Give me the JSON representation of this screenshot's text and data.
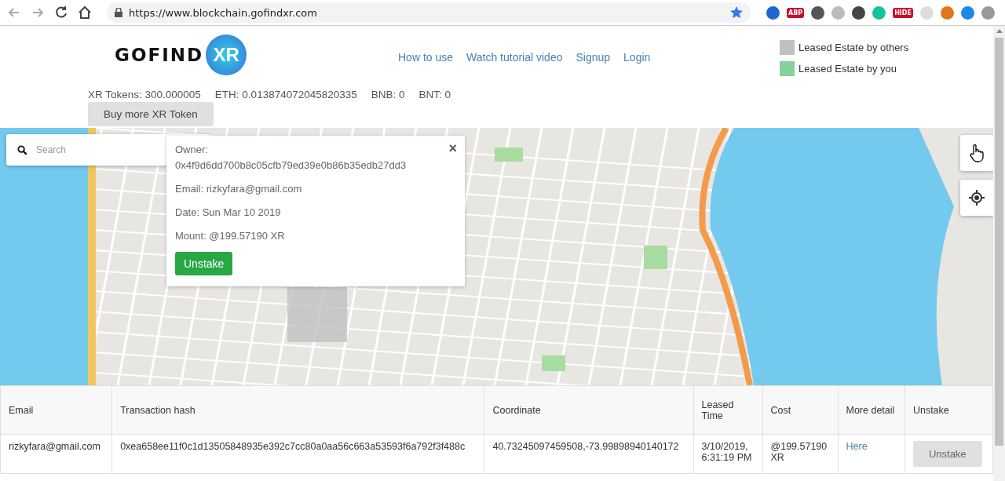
{
  "browser": {
    "url": "https://www.blockchain.gofindxr.com",
    "bookmarked": true,
    "extensions": [
      {
        "kind": "glyph",
        "color": "#1e66d0"
      },
      {
        "kind": "badge",
        "label": "ABP",
        "color": "#c8102e"
      },
      {
        "kind": "glyph",
        "color": "#555555"
      },
      {
        "kind": "glyph",
        "color": "#bbbbbb"
      },
      {
        "kind": "glyph",
        "color": "#444444"
      },
      {
        "kind": "glyph",
        "color": "#15c39a"
      },
      {
        "kind": "badge",
        "label": "HIDE",
        "color": "#c8102e"
      },
      {
        "kind": "glyph",
        "color": "#dddddd"
      },
      {
        "kind": "glyph",
        "color": "#e2761b"
      },
      {
        "kind": "glyph",
        "color": "#1e88e5"
      },
      {
        "kind": "glyph",
        "color": "#999999"
      }
    ]
  },
  "header": {
    "logo": {
      "word": "GOFIND",
      "badge": "XR"
    },
    "nav": [
      "How to use",
      "Watch tutorial video",
      "Signup",
      "Login"
    ],
    "legend": [
      {
        "label": "Leased Estate by others",
        "color": "#c0c0c0"
      },
      {
        "label": "Leased Estate by you",
        "color": "#86d19b"
      }
    ],
    "balances": [
      "XR Tokens: 300.000005",
      "ETH: 0.013874072045820335",
      "BNB: 0",
      "BNT: 0"
    ],
    "buy_button": "Buy more XR Token"
  },
  "map": {
    "search": {
      "placeholder": "Search"
    },
    "popup": {
      "owner_label": "Owner:",
      "owner": "0x4f9d6dd700b8c05cfb79ed39e0b86b35edb27dd3",
      "email": "Email: rizkyfara@gmail.com",
      "date": "Date: Sun Mar 10 2019",
      "mount": "Mount: @199.57190 XR",
      "button": "Unstake",
      "close": "×"
    }
  },
  "table": {
    "columns": [
      "Email",
      "Transaction hash",
      "Coordinate",
      "Leased Time",
      "Cost",
      "More detail",
      "Unstake"
    ],
    "rows": [
      {
        "email": "rizkyfara@gmail.com",
        "hash": "0xea658ee11f0c1d13505848935e392c7cc80a0aa56c663a53593f6a792f3f488c",
        "coordinate": "40.73245097459508,-73.99898940140172",
        "time": "3/10/2019, 6:31:19 PM",
        "cost": "@199.57190 XR",
        "detail": "Here",
        "action": "Unstake",
        "disabled": true
      }
    ]
  }
}
